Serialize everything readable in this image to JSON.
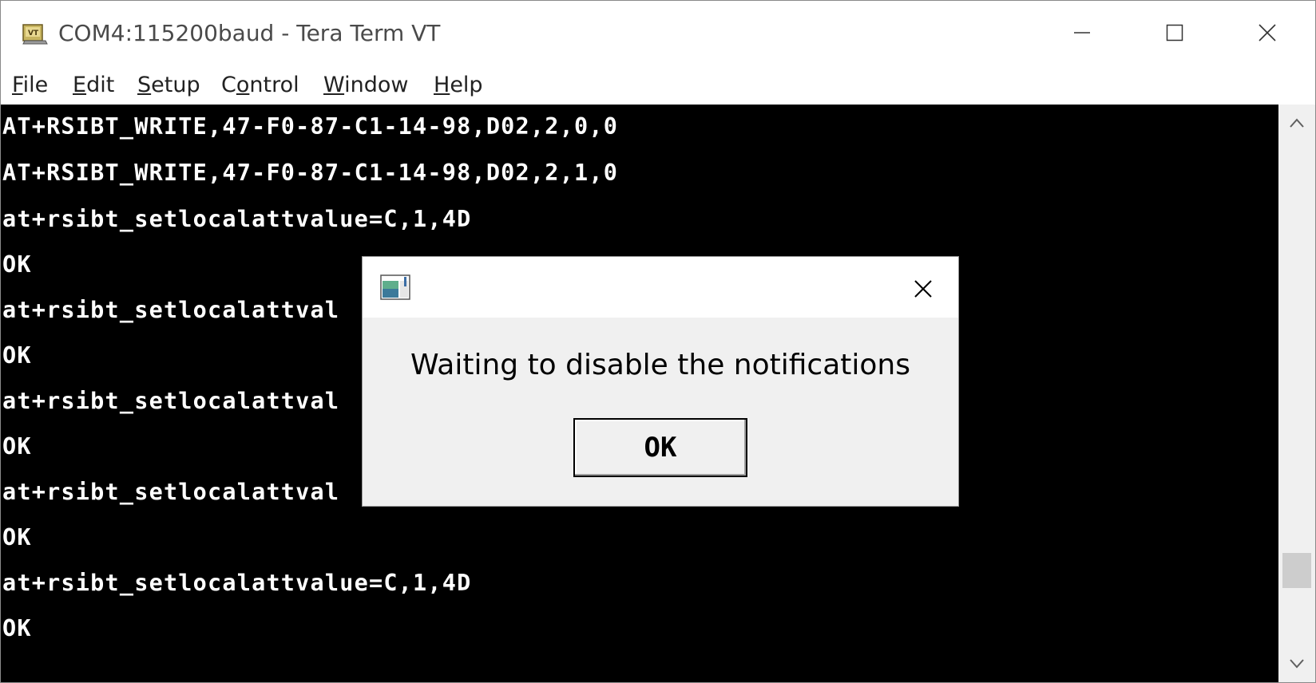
{
  "window": {
    "title": "COM4:115200baud - Tera Term VT",
    "icon": "tera-term-vt-icon",
    "controls": {
      "minimize": "minimize-icon",
      "maximize": "maximize-icon",
      "close": "close-icon"
    }
  },
  "menu": {
    "items": [
      {
        "label": "File",
        "mnemonic": "F"
      },
      {
        "label": "Edit",
        "mnemonic": "E"
      },
      {
        "label": "Setup",
        "mnemonic": "S"
      },
      {
        "label": "Control",
        "mnemonic": "o"
      },
      {
        "label": "Window",
        "mnemonic": "W"
      },
      {
        "label": "Help",
        "mnemonic": "H"
      }
    ]
  },
  "terminal": {
    "background": "#000000",
    "foreground": "#ffffff",
    "lines": [
      "AT+RSIBT_WRITE,47-F0-87-C1-14-98,D02,2,0,0",
      "AT+RSIBT_WRITE,47-F0-87-C1-14-98,D02,2,1,0",
      "at+rsibt_setlocalattvalue=C,1,4D",
      "OK",
      "at+rsibt_setlocalattval",
      "OK",
      "at+rsibt_setlocalattval",
      "OK",
      "at+rsibt_setlocalattval",
      "OK",
      "at+rsibt_setlocalattvalue=C,1,4D",
      "OK"
    ]
  },
  "scrollbar": {
    "up_icon": "chevron-up-icon",
    "down_icon": "chevron-down-icon"
  },
  "dialog": {
    "icon": "application-icon",
    "close_icon": "close-icon",
    "message": "Waiting to disable the notifications",
    "ok_label": "OK"
  }
}
